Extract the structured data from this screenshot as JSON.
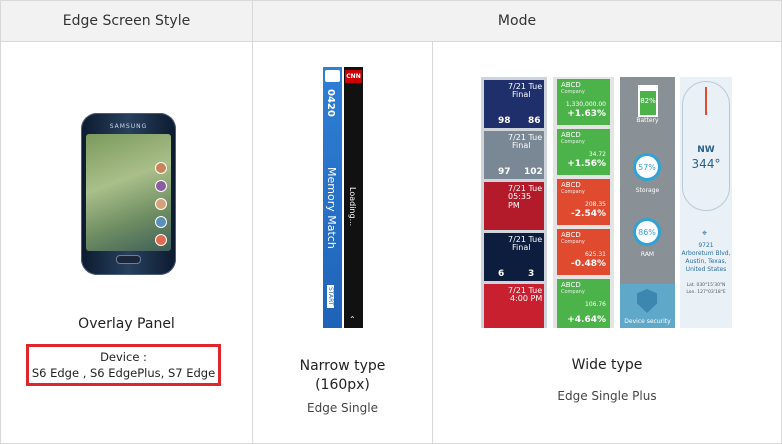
{
  "header": {
    "col1": "Edge Screen Style",
    "col2": "Mode"
  },
  "overlay": {
    "caption": "Overlay Panel",
    "device_line1": "Device :",
    "device_line2": "S6 Edge , S6 EdgePlus, S7 Edge",
    "phone_brand": "SAMSUNG"
  },
  "narrow": {
    "caption_line1": "Narrow type",
    "caption_line2": "(160px)",
    "sub": "Edge Single",
    "strip1_time": "0420",
    "strip1_title": "Memory Match",
    "strip1_start": "START",
    "strip2_logo": "CNN",
    "strip2_text": "Loading..."
  },
  "wide": {
    "caption": "Wide type",
    "sub": "Edge Single Plus",
    "games": [
      {
        "date": "7/21 Tue",
        "status": "Final",
        "left": "98",
        "right": "86"
      },
      {
        "date": "7/21 Tue",
        "status": "Final",
        "left": "97",
        "right": "102"
      },
      {
        "date": "7/21 Tue",
        "status": "05:35 PM",
        "left": "",
        "right": ""
      },
      {
        "date": "7/21 Tue",
        "status": "Final",
        "left": "6",
        "right": "3"
      },
      {
        "date": "7/21 Tue",
        "status": "4:00 PM",
        "left": "",
        "right": ""
      }
    ],
    "stocks": [
      {
        "name": "ABCD",
        "company": "Company",
        "price": "1,330,000.00",
        "change": "+1.63%"
      },
      {
        "name": "ABCD",
        "company": "Company",
        "price": "34.72",
        "change": "+1.56%"
      },
      {
        "name": "ABCD",
        "company": "Company",
        "price": "208.35",
        "change": "-2.54%"
      },
      {
        "name": "ABCD",
        "company": "Company",
        "price": "625.31",
        "change": "-0.48%"
      },
      {
        "name": "ABCD",
        "company": "Company",
        "price": "106.76",
        "change": "+4.64%"
      }
    ],
    "monitor": {
      "battery_pct": "82%",
      "battery_label": "Battery",
      "storage_pct": "57%",
      "storage_label": "Storage",
      "ram_pct": "86%",
      "ram_label": "RAM",
      "security_label": "Device security"
    },
    "compass": {
      "dir": "NW",
      "deg": "344°",
      "code": "9721",
      "addr1": "Arboretum Blvd,",
      "addr2": "Austin, Texas,",
      "addr3": "United States",
      "lat": "Lat. 030°15'30\"N",
      "lon": "Lon. 127°03'18\"E"
    }
  }
}
